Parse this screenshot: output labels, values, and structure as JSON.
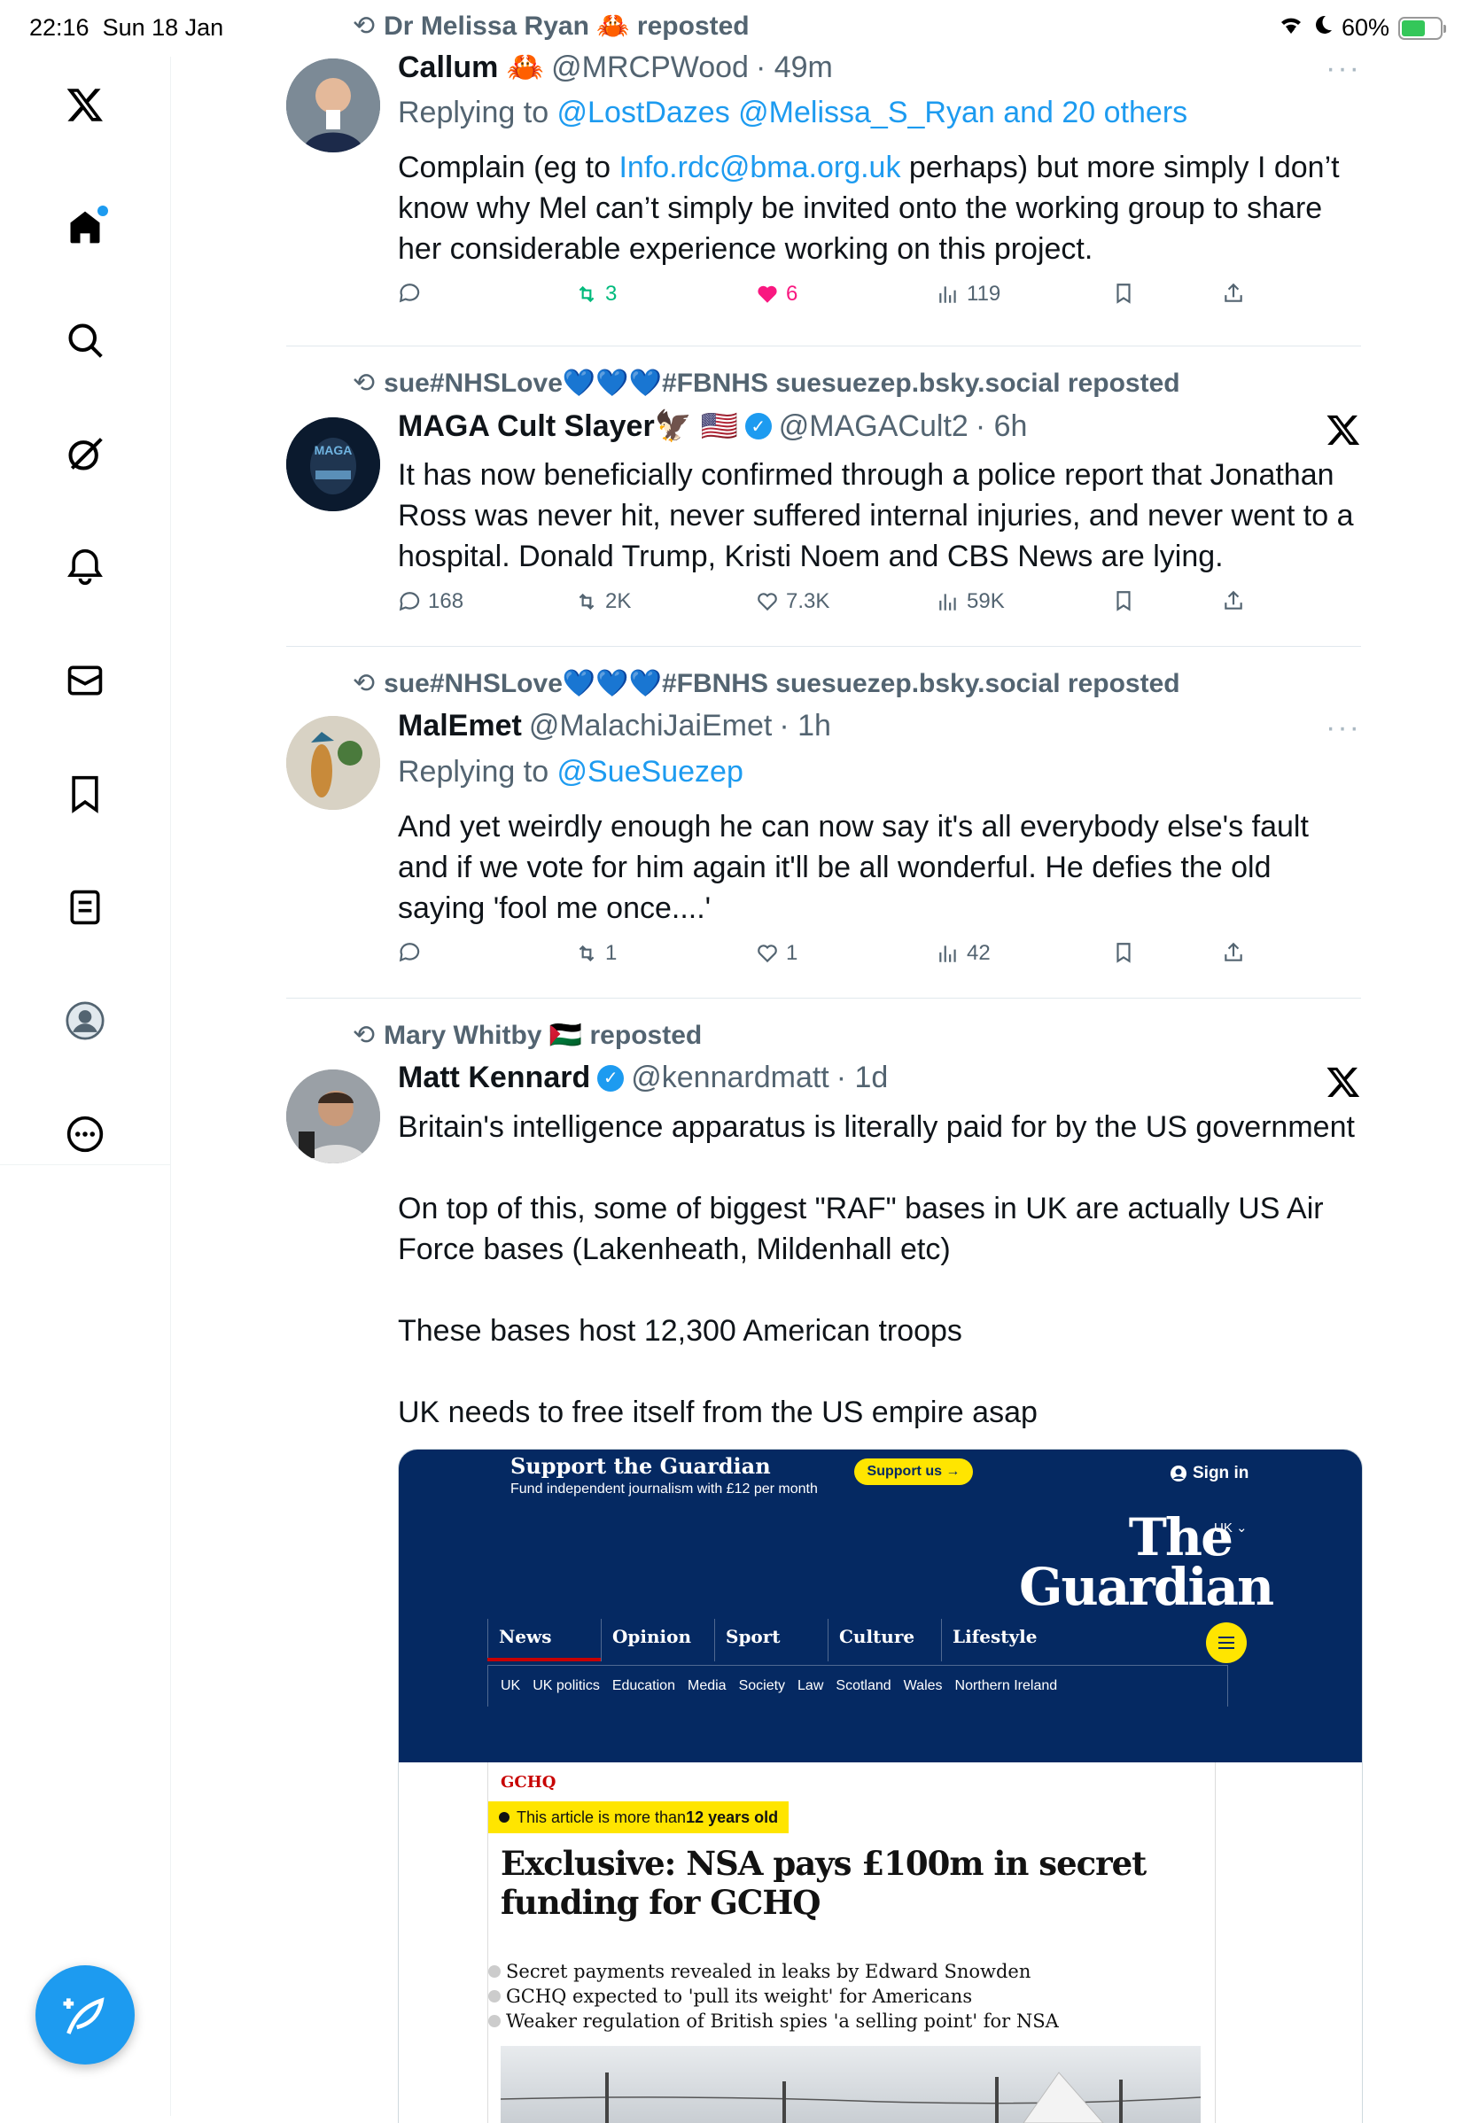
{
  "status_bar": {
    "time": "22:16",
    "date": "Sun 18 Jan",
    "battery": "60%"
  },
  "sidebar": {
    "items": [
      "x-logo",
      "home",
      "search",
      "grok",
      "notifications",
      "messages",
      "bookmarks",
      "lists",
      "profile",
      "more"
    ]
  },
  "tweets": [
    {
      "repost_by": "Dr Melissa Ryan 🦀 reposted",
      "name": "Callum 🦀",
      "handle": "@MRCPWood",
      "time": "· 49m",
      "replying_prefix": "Replying to ",
      "replying_to": "@LostDazes @Melissa_S_Ryan and 20 others",
      "body_pre": "Complain (eg to ",
      "body_link": "Info.rdc@bma.org.uk",
      "body_post": " perhaps) but more simply I don’t know why Mel can’t simply be invited onto the working group to share her considerable experience working on this project.",
      "replies": "",
      "retweets": "3",
      "likes": "6",
      "views": "119"
    },
    {
      "repost_by": "sue#NHSLove💙💙💙#FBNHS suesuezep.bsky.social reposted",
      "name": "MAGA Cult Slayer🦅 🇺🇸",
      "handle": "@MAGACult2",
      "time": "· 6h",
      "body": "It has now beneficially confirmed through a police report that Jonathan Ross was never hit, never suffered internal injuries, and never went to a hospital. Donald Trump, Kristi Noem and CBS News are lying.",
      "replies": "168",
      "retweets": "2K",
      "likes": "7.3K",
      "views": "59K"
    },
    {
      "repost_by": "sue#NHSLove💙💙💙#FBNHS suesuezep.bsky.social reposted",
      "name": "MalEmet",
      "handle": "@MalachiJaiEmet",
      "time": "· 1h",
      "replying_prefix": "Replying to ",
      "replying_to": "@SueSuezep",
      "body": "And yet weirdly enough he can now say it's all everybody else's fault and if we vote for him again it'll be all wonderful. He defies the old saying 'fool me once....'",
      "replies": "",
      "retweets": "1",
      "likes": "1",
      "views": "42"
    },
    {
      "repost_by": "Mary Whitby 🇵🇸 reposted",
      "name": "Matt Kennard",
      "handle": "@kennardmatt",
      "time": "· 1d",
      "body_lines": [
        "Britain's intelligence apparatus is literally paid for by the US government",
        "On top of this, some of biggest \"RAF\" bases in UK are actually US Air Force bases (Lakenheath, Mildenhall etc)",
        "These bases host 12,300 American troops",
        "UK needs to free itself from the US empire asap"
      ]
    }
  ],
  "card": {
    "support_title": "Support the Guardian",
    "support_sub": "Fund independent journalism with £12 per month",
    "support_btn": "Support us →",
    "sign_in": "Sign in",
    "edition": "UK",
    "logo_line1": "The",
    "logo_line2": "Guardian",
    "nav": [
      "News",
      "Opinion",
      "Sport",
      "Culture",
      "Lifestyle"
    ],
    "subnav": [
      "UK",
      "UK politics",
      "Education",
      "Media",
      "Society",
      "Law",
      "Scotland",
      "Wales",
      "Northern Ireland"
    ],
    "kicker": "GCHQ",
    "age_prefix": "This article is more than ",
    "age_bold": "12 years old",
    "headline": "Exclusive: NSA pays £100m in secret funding for GCHQ",
    "bullets": [
      "Secret payments revealed in leaks by Edward Snowden",
      "GCHQ expected to 'pull its weight' for Americans",
      "Weaker regulation of British spies 'a selling point' for NSA"
    ],
    "brand_color": "#052962",
    "accent_color": "#ffe500"
  }
}
